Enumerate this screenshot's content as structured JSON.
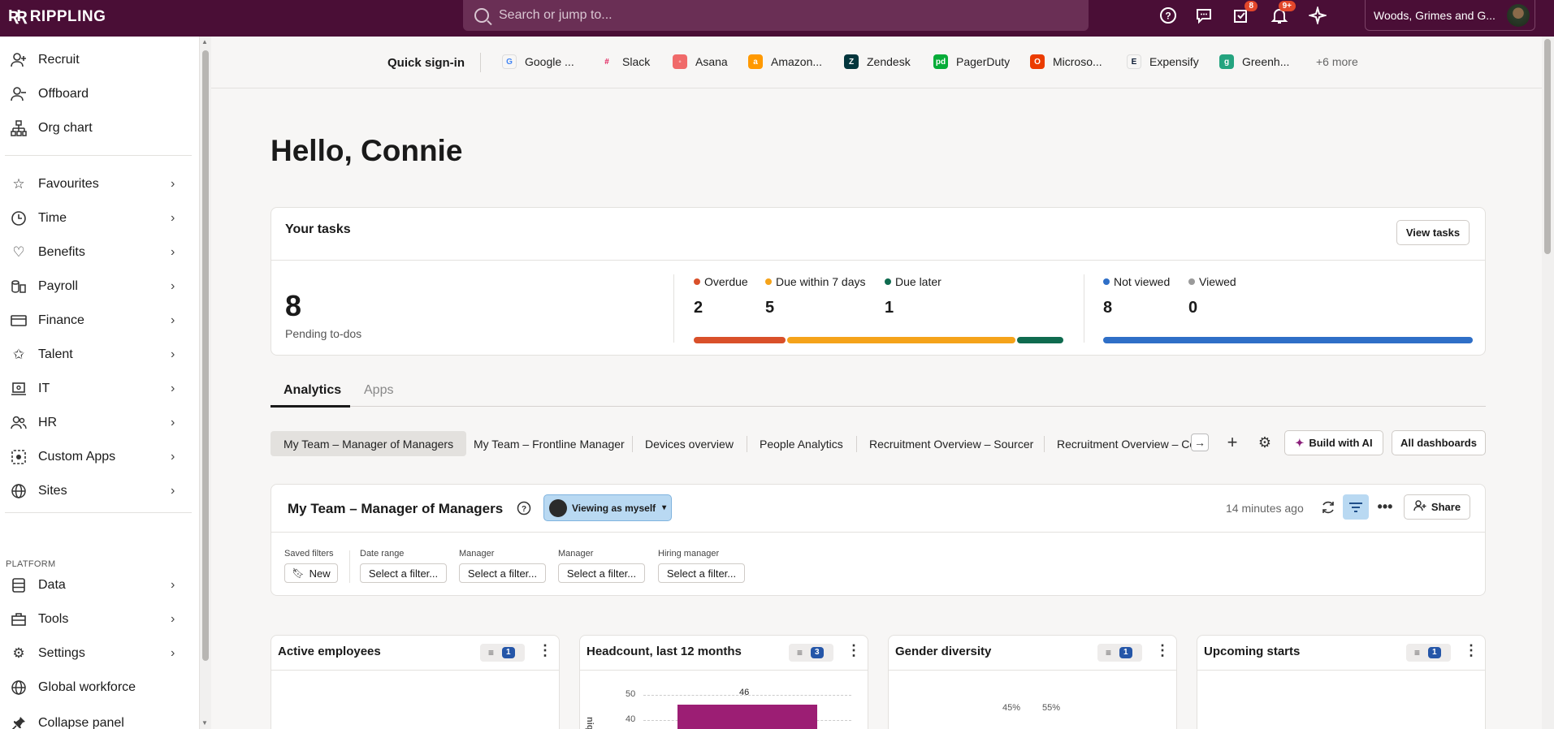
{
  "app": {
    "brand": "RIPPLING",
    "search_placeholder": "Search or jump to...",
    "company": "Woods, Grimes and G...",
    "tasks_badge": "8",
    "notif_badge": "9+"
  },
  "sidebar": {
    "top_items": [
      {
        "label": "Recruit"
      },
      {
        "label": "Offboard"
      },
      {
        "label": "Org chart"
      }
    ],
    "group_items": [
      {
        "label": "Favourites"
      },
      {
        "label": "Time"
      },
      {
        "label": "Benefits"
      },
      {
        "label": "Payroll"
      },
      {
        "label": "Finance"
      },
      {
        "label": "Talent"
      },
      {
        "label": "IT"
      },
      {
        "label": "HR"
      },
      {
        "label": "Custom Apps"
      },
      {
        "label": "Sites"
      }
    ],
    "platform_label": "PLATFORM",
    "platform_items": [
      {
        "label": "Data"
      },
      {
        "label": "Tools"
      },
      {
        "label": "Settings"
      },
      {
        "label": "Global workforce"
      }
    ],
    "collapse_label": "Collapse panel"
  },
  "quick_signin": {
    "title": "Quick sign-in",
    "apps": [
      {
        "label": "Google ...",
        "color": "#ffffff"
      },
      {
        "label": "Slack",
        "color": "#ffffff"
      },
      {
        "label": "Asana",
        "color": "#f06a6a"
      },
      {
        "label": "Amazon...",
        "color": "#ff9900"
      },
      {
        "label": "Zendesk",
        "color": "#03363d"
      },
      {
        "label": "PagerDuty",
        "color": "#06ac38"
      },
      {
        "label": "Microso...",
        "color": "#eb3c00"
      },
      {
        "label": "Expensify",
        "color": "#ffffff"
      },
      {
        "label": "Greenh...",
        "color": "#24a47f"
      }
    ],
    "more": "+6 more"
  },
  "greeting": "Hello, Connie",
  "tasks": {
    "title": "Your tasks",
    "view_button": "View tasks",
    "pending_count": "8",
    "pending_label": "Pending to-dos",
    "overdue_label": "Overdue",
    "overdue_count": "2",
    "due7_label": "Due within 7 days",
    "due7_count": "5",
    "later_label": "Due later",
    "later_count": "1",
    "notviewed_label": "Not viewed",
    "notviewed_count": "8",
    "viewed_label": "Viewed",
    "viewed_count": "0",
    "colors": {
      "overdue": "#d9502a",
      "due7": "#f5a31a",
      "later": "#0f6b4f",
      "notviewed": "#2f6fc7",
      "viewed": "#9a9a9a"
    }
  },
  "tabs": {
    "analytics": "Analytics",
    "apps": "Apps"
  },
  "dashboards": [
    "My Team – Manager of Managers",
    "My Team – Frontline Manager",
    "Devices overview",
    "People Analytics",
    "Recruitment Overview – Sourcer",
    "Recruitment Overview – Co"
  ],
  "dash_buttons": {
    "build_ai": "Build with AI",
    "all": "All dashboards"
  },
  "dashboard": {
    "title": "My Team – Manager of Managers",
    "viewing": "Viewing as myself",
    "updated": "14 minutes ago",
    "share": "Share",
    "filters": [
      {
        "label": "Saved filters",
        "value": "New"
      },
      {
        "label": "Date range",
        "value": "Select a filter..."
      },
      {
        "label": "Manager",
        "value": "Select a filter..."
      },
      {
        "label": "Manager",
        "value": "Select a filter..."
      },
      {
        "label": "Hiring manager",
        "value": "Select a filter..."
      }
    ]
  },
  "widgets": [
    {
      "title": "Active employees",
      "filter_count": "1"
    },
    {
      "title": "Headcount, last 12 months",
      "filter_count": "3"
    },
    {
      "title": "Gender diversity",
      "filter_count": "1"
    },
    {
      "title": "Upcoming starts",
      "filter_count": "1"
    }
  ],
  "headcount_chart": {
    "ticks": [
      "50",
      "40"
    ],
    "ylabel_fragment": "nique)",
    "bar_label": "46"
  },
  "gender_chart": {
    "left": "45%",
    "right": "55%"
  },
  "chart_data": {
    "type": "bar",
    "title": "Headcount, last 12 months",
    "values": [
      46
    ],
    "ylim": [
      0,
      50
    ]
  }
}
